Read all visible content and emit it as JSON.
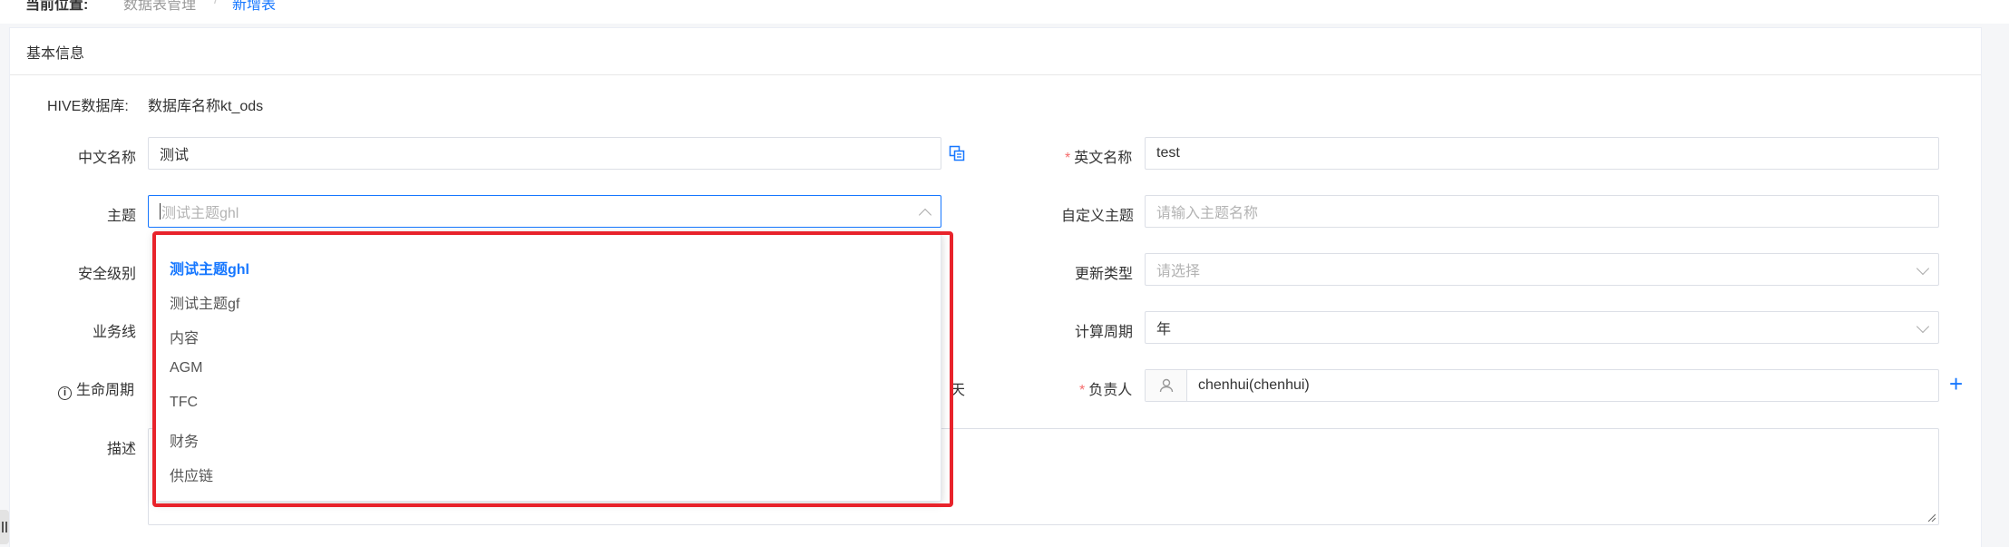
{
  "breadcrumb": {
    "current_label": "当前位置:",
    "item_1": "数据表管理",
    "separator": "/",
    "item_2": "新增表"
  },
  "section": {
    "title": "基本信息"
  },
  "form": {
    "hive_db": {
      "label": "HIVE数据库:",
      "value": "数据库名称kt_ods"
    },
    "cn_name": {
      "label": "中文名称",
      "value": "测试"
    },
    "en_name": {
      "required_mark": "*",
      "label": "英文名称",
      "value": "test"
    },
    "subject": {
      "label": "主题",
      "placeholder": "测试主题ghl"
    },
    "custom_subject": {
      "label": "自定义主题",
      "placeholder": "请输入主题名称"
    },
    "security_level": {
      "label": "安全级别"
    },
    "update_type": {
      "label": "更新类型",
      "placeholder": "请选择"
    },
    "business_line": {
      "label": "业务线"
    },
    "calc_period": {
      "label": "计算周期",
      "value": "年"
    },
    "lifecycle": {
      "label": "生命周期",
      "info_glyph": "i",
      "unit": "天"
    },
    "owner": {
      "required_mark": "*",
      "label": "负责人",
      "value": "chenhui(chenhui)"
    },
    "description": {
      "label": "描述"
    },
    "add_glyph": "+"
  },
  "subject_dropdown": {
    "options": [
      "测试主题ghl",
      "测试主题gf",
      "内容",
      "AGM",
      "TFC",
      "财务",
      "供应链"
    ],
    "selected_index": 0
  },
  "colors": {
    "accent": "#1677ff",
    "highlight": "#e8232b",
    "required": "#f56c6c"
  },
  "icons": [
    "copy-icon",
    "chevron-up-icon",
    "chevron-down-icon",
    "user-icon",
    "plus-icon",
    "info-icon",
    "resize-grip-icon"
  ]
}
